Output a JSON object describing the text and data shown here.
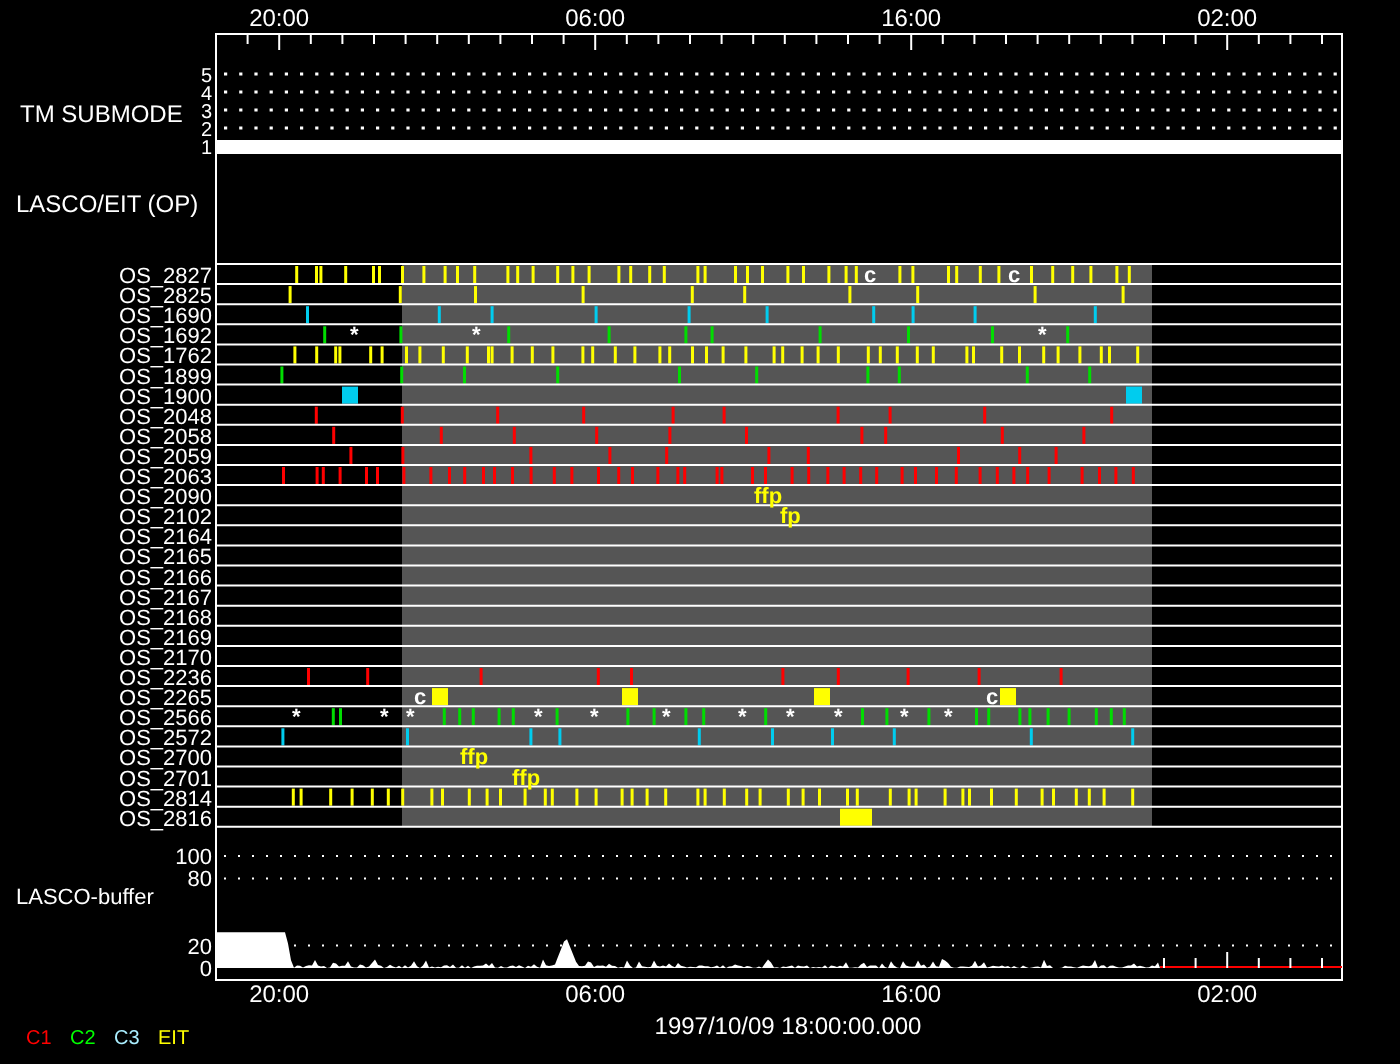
{
  "top_axis": {
    "labels": [
      "20:00",
      "06:00",
      "16:00",
      "02:00"
    ]
  },
  "submode": {
    "label": "TM SUBMODE",
    "levels": [
      {
        "label": "5",
        "active": false
      },
      {
        "label": "4",
        "active": false
      },
      {
        "label": "3",
        "active": false
      },
      {
        "label": "2",
        "active": false
      },
      {
        "label": "1",
        "active": true
      }
    ]
  },
  "section_label": "LASCO/EIT (OP)",
  "rows": [
    {
      "name": "OS_2827",
      "kind": "dense-ticks",
      "color": "#ffff00",
      "annotations": [
        {
          "text": "c",
          "color": "#ffffff"
        },
        {
          "text": "c",
          "color": "#ffffff"
        }
      ]
    },
    {
      "name": "OS_2825",
      "kind": "ticks",
      "color": "#ffff00",
      "annotations": []
    },
    {
      "name": "OS_1690",
      "kind": "ticks",
      "color": "#00ccee",
      "annotations": []
    },
    {
      "name": "OS_1692",
      "kind": "ticks",
      "color": "#00dd00",
      "annotations": [
        {
          "text": "*",
          "color": "#ffffff"
        },
        {
          "text": "*",
          "color": "#ffffff"
        },
        {
          "text": "*",
          "color": "#ffffff"
        }
      ]
    },
    {
      "name": "OS_1762",
      "kind": "dense-ticks",
      "color": "#ffff00",
      "annotations": []
    },
    {
      "name": "OS_1899",
      "kind": "ticks",
      "color": "#00dd00",
      "annotations": []
    },
    {
      "name": "OS_1900",
      "kind": "blocks",
      "color": "#00ccee",
      "annotations": []
    },
    {
      "name": "OS_2048",
      "kind": "ticks",
      "color": "#ff0000",
      "annotations": []
    },
    {
      "name": "OS_2058",
      "kind": "ticks",
      "color": "#ff0000",
      "annotations": []
    },
    {
      "name": "OS_2059",
      "kind": "ticks",
      "color": "#ff0000",
      "annotations": []
    },
    {
      "name": "OS_2063",
      "kind": "dense-ticks",
      "color": "#ff0000",
      "annotations": []
    },
    {
      "name": "OS_2090",
      "kind": "empty",
      "annotations": [
        {
          "text": "ffp",
          "color": "#ffff00"
        }
      ]
    },
    {
      "name": "OS_2102",
      "kind": "empty",
      "annotations": [
        {
          "text": "fp",
          "color": "#ffff00"
        }
      ]
    },
    {
      "name": "OS_2164",
      "kind": "empty",
      "annotations": []
    },
    {
      "name": "OS_2165",
      "kind": "empty",
      "annotations": []
    },
    {
      "name": "OS_2166",
      "kind": "empty",
      "annotations": []
    },
    {
      "name": "OS_2167",
      "kind": "empty",
      "annotations": []
    },
    {
      "name": "OS_2168",
      "kind": "empty",
      "annotations": []
    },
    {
      "name": "OS_2169",
      "kind": "empty",
      "annotations": []
    },
    {
      "name": "OS_2170",
      "kind": "empty",
      "annotations": []
    },
    {
      "name": "OS_2236",
      "kind": "ticks",
      "color": "#ff0000",
      "annotations": []
    },
    {
      "name": "OS_2265",
      "kind": "blocks",
      "color": "#ffff00",
      "annotations": [
        {
          "text": "c",
          "color": "#ffffff"
        },
        {
          "text": "c",
          "color": "#ffffff"
        }
      ]
    },
    {
      "name": "OS_2566",
      "kind": "dense-ticks",
      "color": "#00dd00",
      "annotations": [
        {
          "text": "*",
          "color": "#ffffff"
        },
        {
          "text": "*",
          "color": "#ffffff"
        },
        {
          "text": "*",
          "color": "#ffffff"
        },
        {
          "text": "*",
          "color": "#ffffff"
        },
        {
          "text": "*",
          "color": "#ffffff"
        },
        {
          "text": "*",
          "color": "#ffffff"
        },
        {
          "text": "*",
          "color": "#ffffff"
        },
        {
          "text": "*",
          "color": "#ffffff"
        },
        {
          "text": "*",
          "color": "#ffffff"
        },
        {
          "text": "*",
          "color": "#ffffff"
        },
        {
          "text": "*",
          "color": "#ffffff"
        }
      ]
    },
    {
      "name": "OS_2572",
      "kind": "ticks",
      "color": "#00ccee",
      "annotations": []
    },
    {
      "name": "OS_2700",
      "kind": "empty",
      "annotations": [
        {
          "text": "ffp",
          "color": "#ffff00"
        }
      ]
    },
    {
      "name": "OS_2701",
      "kind": "empty",
      "annotations": [
        {
          "text": "ffp",
          "color": "#ffff00"
        }
      ]
    },
    {
      "name": "OS_2814",
      "kind": "dense-ticks",
      "color": "#ffff00",
      "annotations": []
    },
    {
      "name": "OS_2816",
      "kind": "blocks",
      "color": "#ffff00",
      "annotations": []
    }
  ],
  "buffer": {
    "label": "LASCO-buffer",
    "ticks": [
      "100",
      "80",
      "20",
      "0"
    ]
  },
  "bottom_axis": {
    "labels": [
      "20:00",
      "06:00",
      "16:00",
      "02:00"
    ],
    "date": "1997/10/09 18:00:00.000"
  },
  "legend": [
    {
      "text": "C1",
      "color": "#ff0000"
    },
    {
      "text": "C2",
      "color": "#00ff00"
    },
    {
      "text": "C3",
      "color": "#aaeeff"
    },
    {
      "text": "EIT",
      "color": "#ffff00"
    }
  ]
}
